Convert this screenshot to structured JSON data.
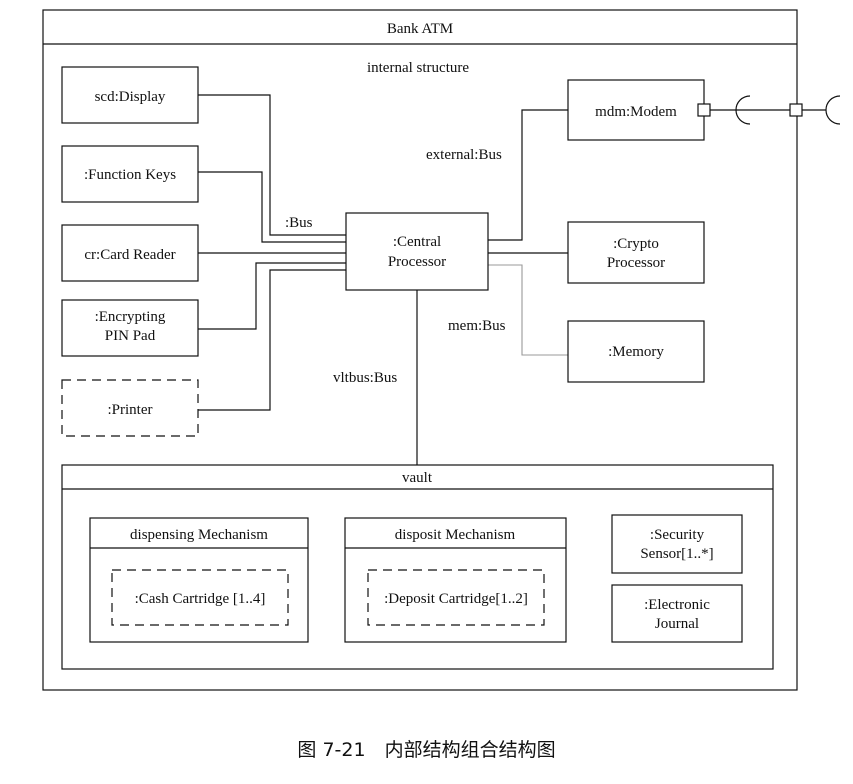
{
  "diagram": {
    "title": "Bank ATM",
    "section_label": "internal structure",
    "parts": {
      "display": "scd:Display",
      "function_keys": ":Function Keys",
      "card_reader": "cr:Card Reader",
      "pin_pad": [
        ":Encrypting",
        "PIN Pad"
      ],
      "printer": ":Printer",
      "cpu": [
        ":Central",
        "Processor"
      ],
      "modem": "mdm:Modem",
      "crypto": [
        ":Crypto",
        "Processor"
      ],
      "memory": ":Memory"
    },
    "connectors": {
      "bus": ":Bus",
      "external": "external:Bus",
      "mem": "mem:Bus",
      "vlt": "vltbus:Bus"
    },
    "vault": {
      "title": "vault",
      "dispensing": {
        "title": "dispensing Mechanism",
        "part": ":Cash Cartridge [1..4]"
      },
      "deposit": {
        "title": "disposit Mechanism",
        "part": ":Deposit Cartridge[1..2]"
      },
      "security_sensor": [
        ":Security",
        "Sensor[1..*]"
      ],
      "journal": [
        ":Electronic",
        "Journal"
      ]
    }
  },
  "caption": "图 7-21　内部结构组合结构图"
}
